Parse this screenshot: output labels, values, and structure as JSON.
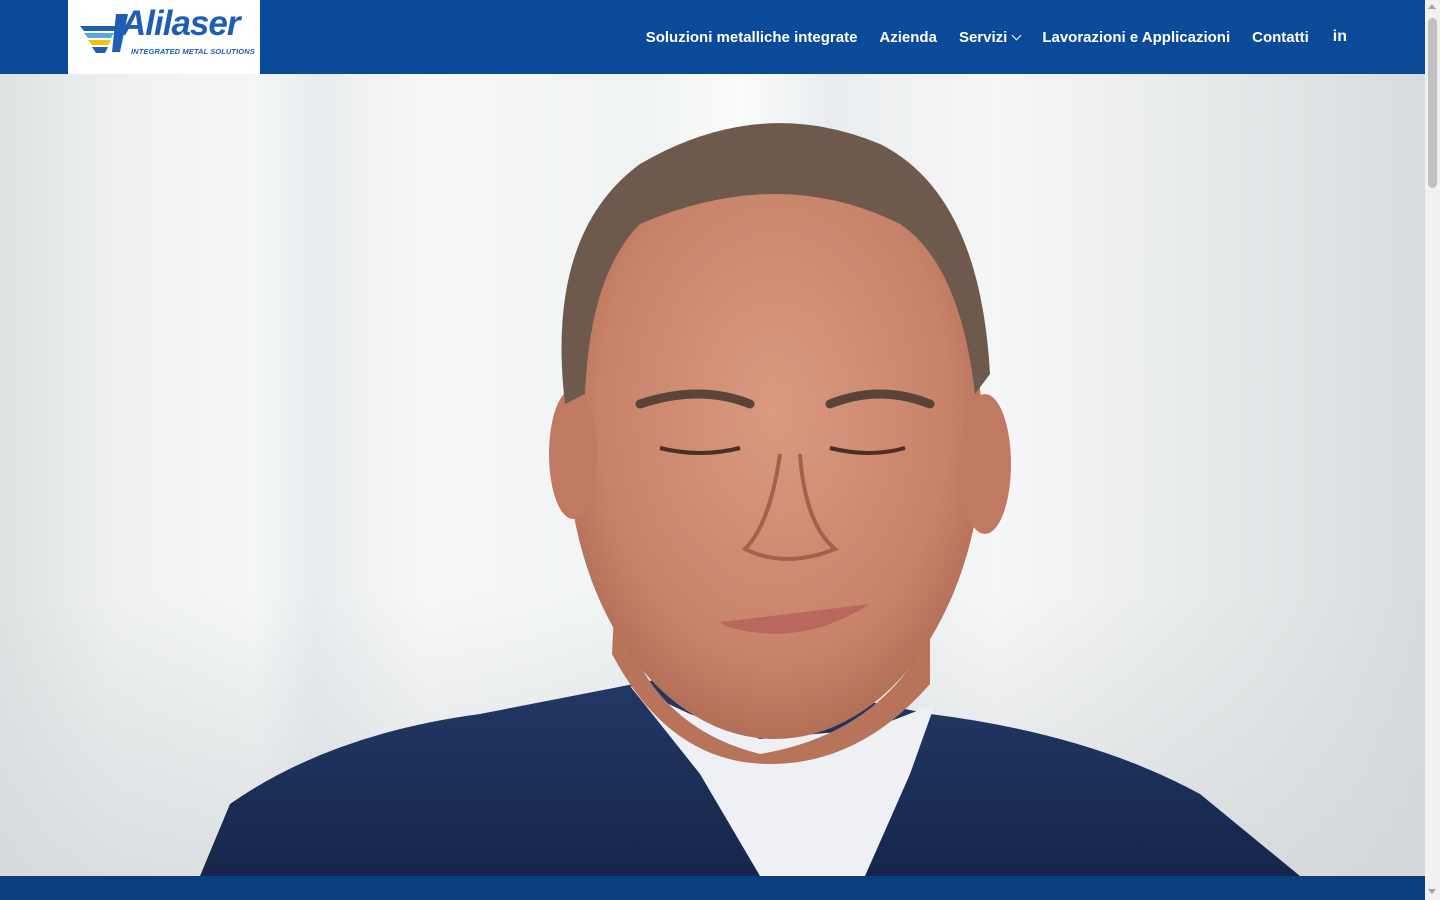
{
  "header": {
    "logo": {
      "name": "Alilaser",
      "tagline": "INTEGRATED METAL SOLUTIONS",
      "colors": {
        "blue": "#1e5fb3",
        "yellow": "#f2c500",
        "light_blue": "#5aa7e0"
      }
    },
    "nav": [
      {
        "label": "Soluzioni metalliche integrate"
      },
      {
        "label": "Azienda"
      },
      {
        "label": "Servizi",
        "has_dropdown": true
      },
      {
        "label": "Lavorazioni e Applicazioni"
      },
      {
        "label": "Contatti"
      },
      {
        "label": "in",
        "icon": "linkedin-icon"
      }
    ],
    "colors": {
      "background": "#0a4a98",
      "text": "#ffffff"
    }
  },
  "hero": {
    "media": "video-still-portrait-man-in-navy-blazer"
  },
  "footer_band": {
    "color": "#0a3f7f"
  }
}
